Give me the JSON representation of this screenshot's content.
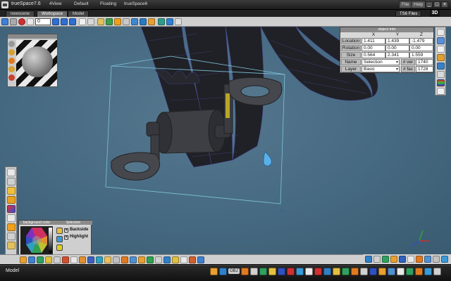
{
  "app": {
    "title": "trueSpace7.6",
    "menu": [
      "4View",
      "Default",
      "Floating",
      "trueSpace6"
    ],
    "right_buttons": [
      "File",
      "Help"
    ]
  },
  "tabs": {
    "items": [
      "newscene",
      "Workspace",
      "Model"
    ],
    "right_label": "TS6 Files",
    "view_label": "3D"
  },
  "toolbar_top": {
    "frame_counter": "0"
  },
  "object_info": {
    "header": "object info",
    "columns": [
      "X",
      "Y",
      "Z"
    ],
    "rows": [
      {
        "label": "Location",
        "x": "1.411",
        "y": "1.439",
        "z": "-1.479"
      },
      {
        "label": "Rotation",
        "x": "0.00",
        "y": "0.00",
        "z": "0.00"
      },
      {
        "label": "Size",
        "x": "0.564",
        "y": "2.341",
        "z": "1.559"
      }
    ],
    "name_label": "Name",
    "name_value": "Selection",
    "vert_label": "# ver",
    "vert_value": "1740",
    "layer_label": "Layer",
    "layer_value": "Basic",
    "face_label": "# fac",
    "face_value": "1728"
  },
  "color_panel": {
    "bg_header": "background color",
    "sel_header": "Selection",
    "options": [
      {
        "label": "Backside",
        "checked": true
      },
      {
        "label": "Highlight",
        "checked": true
      }
    ]
  },
  "statusbar": {
    "mode": "Model",
    "obj_label": "OBJ"
  }
}
